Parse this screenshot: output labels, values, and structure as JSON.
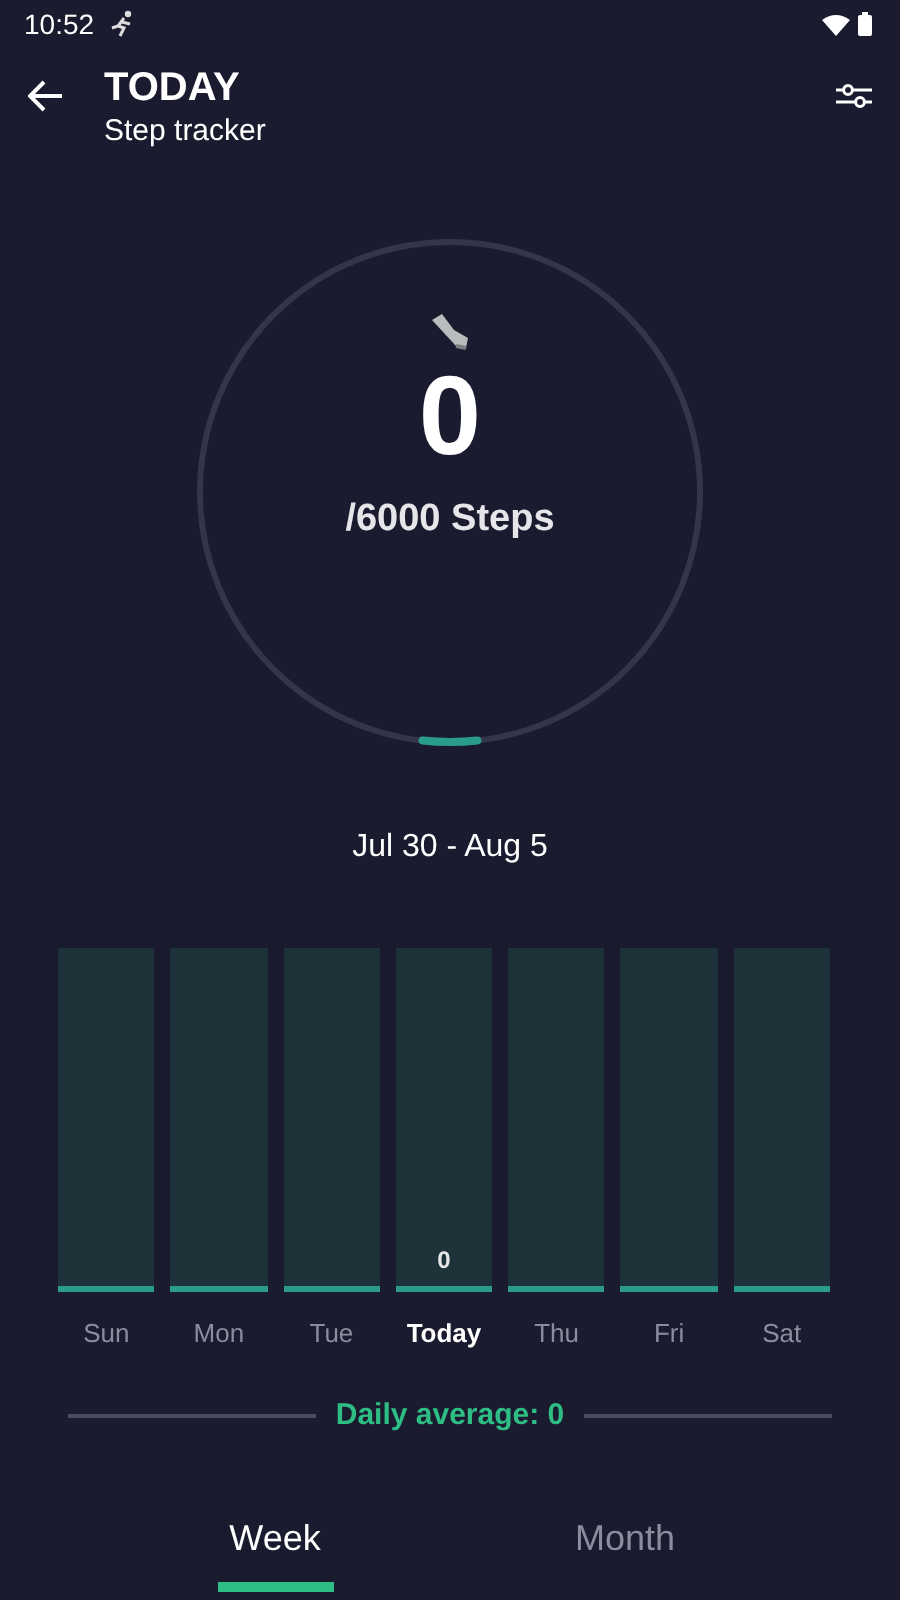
{
  "status_bar": {
    "time": "10:52"
  },
  "header": {
    "title": "TODAY",
    "subtitle": "Step tracker"
  },
  "progress": {
    "steps": "0",
    "goal": "/6000 Steps"
  },
  "date_range": "Jul 30 - Aug 5",
  "days": [
    {
      "label": "Sun",
      "selected": false
    },
    {
      "label": "Mon",
      "selected": false
    },
    {
      "label": "Tue",
      "selected": false
    },
    {
      "label": "Today",
      "selected": true,
      "value": "0"
    },
    {
      "label": "Thu",
      "selected": false
    },
    {
      "label": "Fri",
      "selected": false
    },
    {
      "label": "Sat",
      "selected": false
    }
  ],
  "daily_average": "Daily average: 0",
  "tabs": [
    {
      "label": "Week",
      "selected": true
    },
    {
      "label": "Month",
      "selected": false
    }
  ]
}
